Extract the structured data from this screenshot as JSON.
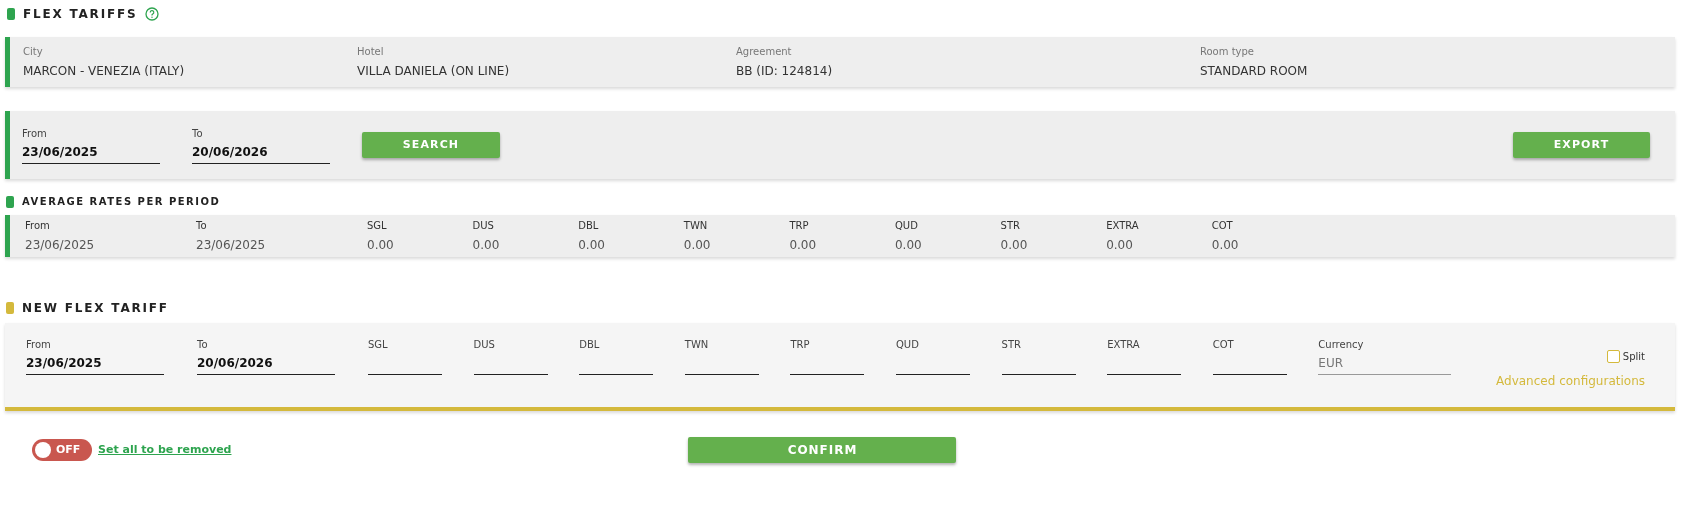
{
  "title": "FLEX TARIFFS",
  "info": [
    {
      "label": "City",
      "value": "MARCON - VENEZIA (ITALY)"
    },
    {
      "label": "Hotel",
      "value": "VILLA DANIELA (ON LINE)"
    },
    {
      "label": "Agreement",
      "value": "BB (ID: 124814)"
    },
    {
      "label": "Room type",
      "value": "STANDARD ROOM"
    }
  ],
  "search": {
    "from": {
      "label": "From",
      "value": "23/06/2025"
    },
    "to": {
      "label": "To",
      "value": "20/06/2026"
    },
    "search_button": "SEARCH",
    "export_button": "EXPORT"
  },
  "average": {
    "title": "AVERAGE RATES PER PERIOD",
    "columns": [
      {
        "label": "From",
        "value": "23/06/2025"
      },
      {
        "label": "To",
        "value": "23/06/2025"
      },
      {
        "label": "SGL",
        "value": "0.00"
      },
      {
        "label": "DUS",
        "value": "0.00"
      },
      {
        "label": "DBL",
        "value": "0.00"
      },
      {
        "label": "TWN",
        "value": "0.00"
      },
      {
        "label": "TRP",
        "value": "0.00"
      },
      {
        "label": "QUD",
        "value": "0.00"
      },
      {
        "label": "STR",
        "value": "0.00"
      },
      {
        "label": "EXTRA",
        "value": "0.00"
      },
      {
        "label": "COT",
        "value": "0.00"
      }
    ]
  },
  "new_tariff": {
    "title": "NEW FLEX TARIFF",
    "dates": [
      {
        "label": "From",
        "value": "23/06/2025"
      },
      {
        "label": "To",
        "value": "20/06/2026"
      }
    ],
    "rates": [
      "SGL",
      "DUS",
      "DBL",
      "TWN",
      "TRP",
      "QUD",
      "STR",
      "EXTRA",
      "COT"
    ],
    "currency": {
      "label": "Currency",
      "value": "EUR"
    },
    "split": {
      "label": "Split",
      "checked": false
    },
    "advanced_link": "Advanced configurations"
  },
  "remove_toggle": {
    "label": "OFF",
    "on": false
  },
  "remove_link": "Set all to be removed",
  "confirm_button": "CONFIRM"
}
